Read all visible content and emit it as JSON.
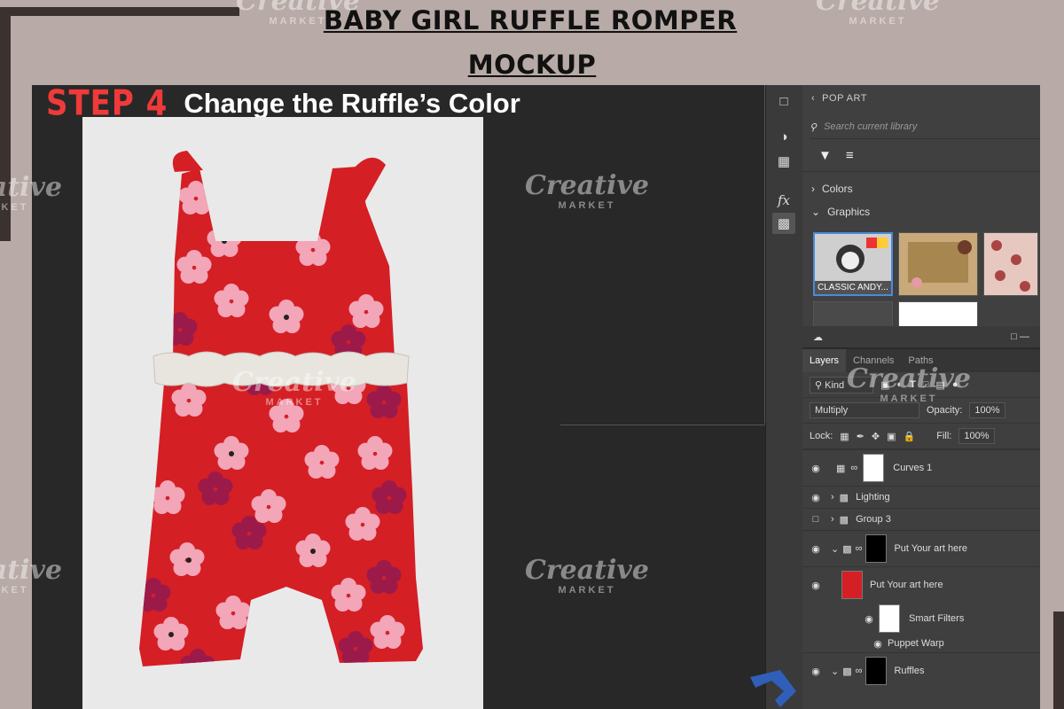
{
  "header": {
    "title_line1": "BABY GIRL RUFFLE ROMPER",
    "title_line2": "MOCKUP"
  },
  "watermark": {
    "brand": "Creative",
    "sub": "MARKET"
  },
  "step": {
    "number": "STEP 4",
    "text": "Change the Ruffle’s Color"
  },
  "colors": {
    "step_red": "#f03a3a",
    "romper_red": "#d41f25",
    "flower_pink": "#f2a6b8",
    "flower_magenta": "#9c1a4a",
    "ruffle": "#e8e4de"
  },
  "toolbar": {
    "icons": [
      "comment-icon",
      "palette-icon",
      "grid-icon",
      "fx-icon",
      "libraries-icon"
    ]
  },
  "library": {
    "name": "POP ART",
    "search_placeholder": "Search current library",
    "colors_section": "Colors",
    "graphics_section": "Graphics",
    "thumb1_caption": "CLASSIC ANDY..."
  },
  "layers_panel": {
    "tabs": [
      "Layers",
      "Channels",
      "Paths"
    ],
    "filter_kind": "Kind",
    "blend_mode": "Multiply",
    "opacity_label": "Opacity:",
    "opacity_value": "100%",
    "lock_label": "Lock:",
    "fill_label": "Fill:",
    "fill_value": "100%",
    "layers": [
      {
        "name": "Curves 1"
      },
      {
        "name": "Lighting"
      },
      {
        "name": "Group 3"
      },
      {
        "name": "Put Your art here"
      },
      {
        "name": "Put Your art here"
      },
      {
        "name": "Smart Filters"
      },
      {
        "name": "Puppet Warp"
      },
      {
        "name": "Ruffles"
      }
    ]
  }
}
